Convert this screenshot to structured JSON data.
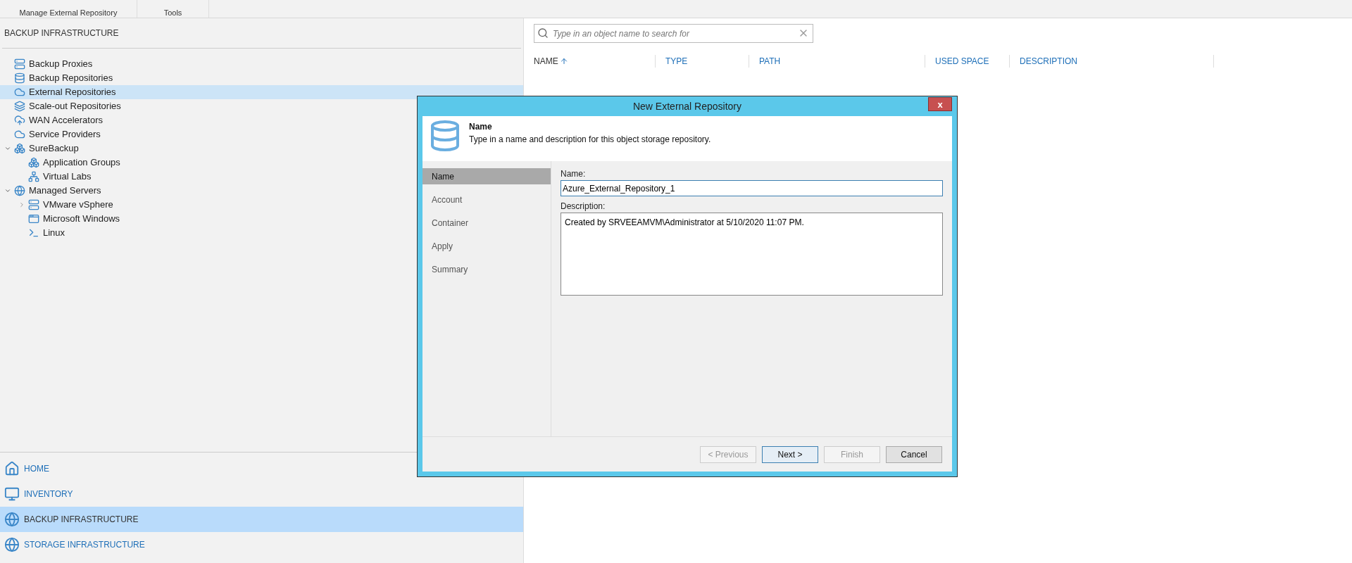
{
  "ribbon": {
    "groups": [
      "Manage External Repository",
      "Tools"
    ]
  },
  "sidebar": {
    "title": "BACKUP INFRASTRUCTURE",
    "tree": [
      {
        "label": "Backup Proxies",
        "selected": false
      },
      {
        "label": "Backup Repositories",
        "selected": false
      },
      {
        "label": "External Repositories",
        "selected": true
      },
      {
        "label": "Scale-out Repositories",
        "selected": false
      },
      {
        "label": "WAN Accelerators",
        "selected": false
      },
      {
        "label": "Service Providers",
        "selected": false
      },
      {
        "label": "SureBackup",
        "selected": false,
        "expanded": true,
        "children": [
          {
            "label": "Application Groups",
            "selected": false
          },
          {
            "label": "Virtual Labs",
            "selected": false
          }
        ]
      },
      {
        "label": "Managed Servers",
        "selected": false,
        "expanded": true,
        "children": [
          {
            "label": "VMware vSphere",
            "selected": false,
            "expanded": false
          },
          {
            "label": "Microsoft Windows",
            "selected": false
          },
          {
            "label": "Linux",
            "selected": false
          }
        ]
      }
    ],
    "nav": [
      {
        "label": "HOME",
        "selected": false
      },
      {
        "label": "INVENTORY",
        "selected": false
      },
      {
        "label": "BACKUP INFRASTRUCTURE",
        "selected": true
      },
      {
        "label": "STORAGE INFRASTRUCTURE",
        "selected": false
      }
    ]
  },
  "main": {
    "search": {
      "placeholder": "Type in an object name to search for"
    },
    "columns": [
      {
        "label": "NAME",
        "sorted": true
      },
      {
        "label": "TYPE",
        "sorted": false
      },
      {
        "label": "PATH",
        "sorted": false
      },
      {
        "label": "USED SPACE",
        "sorted": false
      },
      {
        "label": "DESCRIPTION",
        "sorted": false
      }
    ]
  },
  "dialog": {
    "title": "New External Repository",
    "close": "x",
    "header": {
      "title": "Name",
      "subtitle": "Type in a name and description for this object storage repository."
    },
    "steps": [
      {
        "label": "Name",
        "selected": true
      },
      {
        "label": "Account",
        "selected": false
      },
      {
        "label": "Container",
        "selected": false
      },
      {
        "label": "Apply",
        "selected": false
      },
      {
        "label": "Summary",
        "selected": false
      }
    ],
    "name_label": "Name:",
    "name_value": "Azure_External_Repository_1",
    "description_label": "Description:",
    "description_value": "Created by SRVEEAMVM\\Administrator at 5/10/2020 11:07 PM.",
    "buttons": [
      {
        "label": "< Previous",
        "disabled": true,
        "default": false
      },
      {
        "label": "Next >",
        "disabled": false,
        "default": true
      },
      {
        "label": "Finish",
        "disabled": true,
        "default": false
      },
      {
        "label": "Cancel",
        "disabled": false,
        "default": false
      }
    ]
  }
}
